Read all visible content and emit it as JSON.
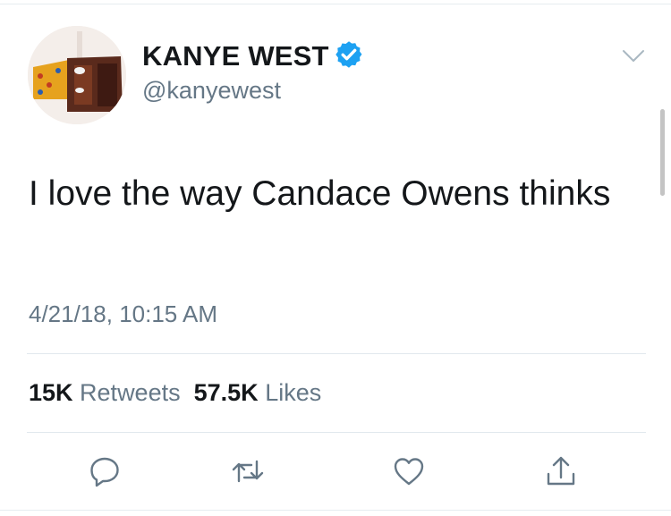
{
  "tweet": {
    "author": {
      "display_name": "KANYE WEST",
      "handle": "@kanyewest",
      "verified": true
    },
    "text": "I love the way Candace Owens thinks",
    "timestamp": "4/21/18, 10:15 AM",
    "stats": {
      "retweets_count": "15K",
      "retweets_label": "Retweets",
      "likes_count": "57.5K",
      "likes_label": "Likes"
    },
    "actions": [
      "reply-icon",
      "retweet-icon",
      "like-icon",
      "share-icon"
    ]
  },
  "colors": {
    "text_primary": "#14171a",
    "text_secondary": "#657786",
    "verified_blue": "#1da1f2",
    "divider": "#e1e8ed",
    "icon_gray": "#657786"
  }
}
